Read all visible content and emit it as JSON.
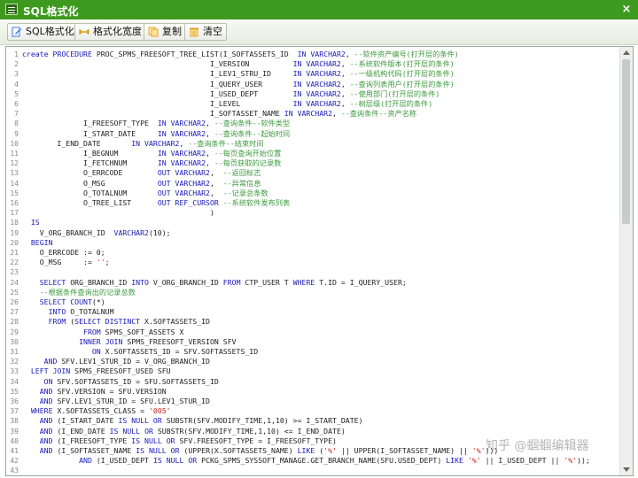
{
  "window": {
    "title": "SQL格式化",
    "close_label": "×"
  },
  "toolbar": {
    "buttons": [
      {
        "label": "SQL格式化",
        "icon": "edit-icon",
        "color": "#3b7be0"
      },
      {
        "label": "格式化宽度",
        "icon": "width-icon",
        "color": "#e0a21f"
      },
      {
        "label": "复制",
        "icon": "copy-icon",
        "color": "#e0a21f"
      },
      {
        "label": "清空",
        "icon": "trash-icon",
        "color": "#e0a21f"
      }
    ]
  },
  "code_lines": [
    {
      "n": "1",
      "text": "create PROCEDURE PROC_SPMS_FREESOFT_TREE_LIST(I_SOFTASSETS_ID  IN VARCHAR2, --软件资产编号(打开层的条件)"
    },
    {
      "n": "2",
      "text": "                                           I_VERSION          IN VARCHAR2, --系统软件版本(打开层的条件)"
    },
    {
      "n": "3",
      "text": "                                           I_LEV1_STRU_ID     IN VARCHAR2, --一级机构代码(打开层的条件)"
    },
    {
      "n": "4",
      "text": "                                           I_QUERY_USER       IN VARCHAR2, --查询列表用户(打开层的条件)"
    },
    {
      "n": "5",
      "text": "                                           I_USED_DEPT        IN VARCHAR2, --使用部门(打开层的条件)"
    },
    {
      "n": "6",
      "text": "                                           I_LEVEL            IN VARCHAR2, --树层级(打开层的条件)"
    },
    {
      "n": "7",
      "text": "                                           I_SOFTASSET_NAME IN VARCHAR2, --查询条件--资产名称"
    },
    {
      "n": "8",
      "text": "              I_FREESOFT_TYPE  IN VARCHAR2, --查询条件--软件类型"
    },
    {
      "n": "9",
      "text": "              I_START_DATE     IN VARCHAR2, --查询条件--起始时间"
    },
    {
      "n": "10",
      "text": "        I_END_DATE       IN VARCHAR2, --查询条件--结束时间"
    },
    {
      "n": "11",
      "text": "              I_BEGNUM         IN VARCHAR2, --每页查询开始位置"
    },
    {
      "n": "12",
      "text": "              I_FETCHNUM       IN VARCHAR2, --每页获取的记录数"
    },
    {
      "n": "13",
      "text": "              O_ERRCODE        OUT VARCHAR2,  --返回标志"
    },
    {
      "n": "14",
      "text": "              O_MSG            OUT VARCHAR2,  --异常信息"
    },
    {
      "n": "15",
      "text": "              O_TOTALNUM       OUT VARCHAR2,  --记录总条数"
    },
    {
      "n": "16",
      "text": "              O_TREE_LIST      OUT REF_CURSOR --系统软件发布列表"
    },
    {
      "n": "17",
      "text": "                                           )"
    },
    {
      "n": "18",
      "text": "  IS"
    },
    {
      "n": "19",
      "text": "    V_ORG_BRANCH_ID  VARCHAR2(10);"
    },
    {
      "n": "20",
      "text": "  BEGIN"
    },
    {
      "n": "21",
      "text": "    O_ERRCODE := 0;"
    },
    {
      "n": "22",
      "text": "    O_MSG     := '';"
    },
    {
      "n": "23",
      "text": ""
    },
    {
      "n": "24",
      "text": "    SELECT ORG_BRANCH_ID INTO V_ORG_BRANCH_ID FROM CTP_USER T WHERE T.ID = I_QUERY_USER;"
    },
    {
      "n": "25",
      "text": "    --根据条件查询出的记录总数"
    },
    {
      "n": "26",
      "text": "    SELECT COUNT(*)"
    },
    {
      "n": "27",
      "text": "      INTO O_TOTALNUM"
    },
    {
      "n": "28",
      "text": "      FROM (SELECT DISTINCT X.SOFTASSETS_ID"
    },
    {
      "n": "29",
      "text": "              FROM SPMS_SOFT_ASSETS X"
    },
    {
      "n": "30",
      "text": "             INNER JOIN SPMS_FREESOFT_VERSION SFV"
    },
    {
      "n": "31",
      "text": "                ON X.SOFTASSETS_ID = SFV.SOFTASSETS_ID"
    },
    {
      "n": "32",
      "text": "     AND SFV.LEV1_STUR_ID = V_ORG_BRANCH_ID"
    },
    {
      "n": "33",
      "text": "  LEFT JOIN SPMS_FREESOFT_USED SFU"
    },
    {
      "n": "34",
      "text": "     ON SFV.SOFTASSETS_ID = SFU.SOFTASSETS_ID"
    },
    {
      "n": "35",
      "text": "    AND SFV.VERSION = SFU.VERSION"
    },
    {
      "n": "36",
      "text": "    AND SFV.LEV1_STUR_ID = SFU.LEV1_STUR_ID"
    },
    {
      "n": "37",
      "text": "  WHERE X.SOFTASSETS_CLASS = '005'"
    },
    {
      "n": "38",
      "text": "    AND (I_START_DATE IS NULL OR SUBSTR(SFV.MODIFY_TIME,1,10) >= I_START_DATE)"
    },
    {
      "n": "39",
      "text": "    AND (I_END_DATE IS NULL OR SUBSTR(SFV.MODIFY_TIME,1,10) <= I_END_DATE)"
    },
    {
      "n": "40",
      "text": "    AND (I_FREESOFT_TYPE IS NULL OR SFV.FREESOFT_TYPE = I_FREESOFT_TYPE)"
    },
    {
      "n": "41",
      "text": "    AND (I_SOFTASSET_NAME IS NULL OR (UPPER(X.SOFTASSETS_NAME) LIKE ('%' || UPPER(I_SOFTASSET_NAME) || '%')))"
    },
    {
      "n": "42",
      "text": "             AND (I_USED_DEPT IS NULL OR PCKG_SPMS_SYSSOFT_MANAGE.GET_BRANCH_NAME(SFU.USED_DEPT) LIKE '%' || I_USED_DEPT || '%'));"
    },
    {
      "n": "43",
      "text": ""
    }
  ],
  "watermark": "知乎 @蝈蝈编辑器",
  "colors": {
    "titlebar": "#3d9a1e",
    "keyword": "#1a1ab8",
    "comment": "#3e9a3e",
    "string": "#c42020"
  }
}
